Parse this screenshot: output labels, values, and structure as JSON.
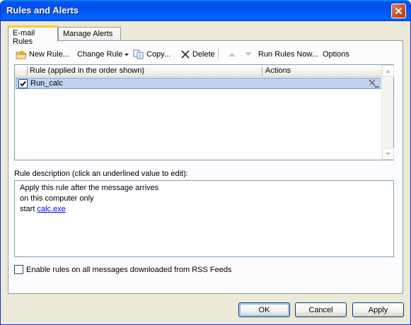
{
  "window": {
    "title": "Rules and Alerts"
  },
  "tabs": [
    {
      "label": "E-mail Rules",
      "active": true
    },
    {
      "label": "Manage Alerts",
      "active": false
    }
  ],
  "toolbar": {
    "new_rule": "New Rule...",
    "change_rule": "Change Rule",
    "copy": "Copy...",
    "delete": "Delete",
    "run_rules_now": "Run Rules Now...",
    "options": "Options"
  },
  "rules_list": {
    "columns": [
      "Rule (applied in the order shown)",
      "Actions"
    ],
    "rows": [
      {
        "name": "Run_calc",
        "checked": true,
        "selected": true
      }
    ]
  },
  "description": {
    "label": "Rule description (click an underlined value to edit):",
    "line1": "Apply this rule after the message arrives",
    "line2": "on this computer only",
    "line3_prefix": "start ",
    "line3_link": "calc.exe"
  },
  "rss_option": {
    "label": "Enable rules on all messages downloaded from RSS Feeds",
    "checked": false
  },
  "buttons": {
    "ok": "OK",
    "cancel": "Cancel",
    "apply": "Apply"
  },
  "colors": {
    "titlebar": "#0054e3",
    "selection": "#c1d2ee",
    "dialog_bg": "#ece9d8",
    "link": "#0000ff"
  }
}
